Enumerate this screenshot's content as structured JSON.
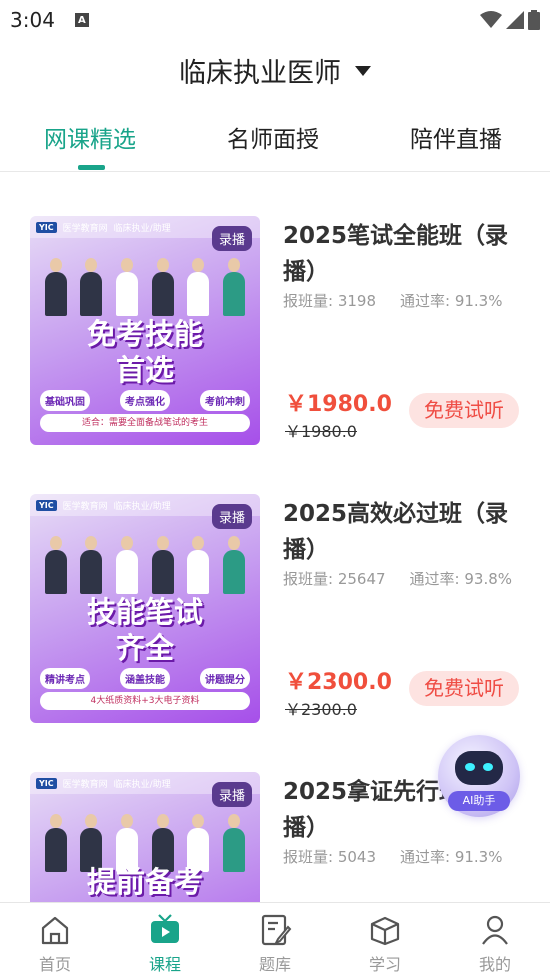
{
  "status_bar": {
    "time": "3:04",
    "notif_glyph": "A"
  },
  "header": {
    "title": "临床执业医师"
  },
  "tabs": [
    {
      "label": "网课精选",
      "active": true
    },
    {
      "label": "名师面授",
      "active": false
    },
    {
      "label": "陪伴直播",
      "active": false
    }
  ],
  "courses": [
    {
      "title": "2025笔试全能班（录播）",
      "enroll": "报班量: 3198",
      "pass_rate": "通过率: 91.3%",
      "price": "￥1980.0",
      "orig_price": "￥1980.0",
      "trial": "免费试听",
      "thumb": {
        "org": "医学教育网",
        "cat": "临床执业/助理",
        "badge": "录播",
        "headline1": "免考技能",
        "headline2": "首选",
        "pills": [
          "基础巩固",
          "考点强化",
          "考前冲刺"
        ],
        "footer": "适合：需要全面备战笔试的考生"
      }
    },
    {
      "title": "2025高效必过班（录播）",
      "enroll": "报班量: 25647",
      "pass_rate": "通过率: 93.8%",
      "price": "￥2300.0",
      "orig_price": "￥2300.0",
      "trial": "免费试听",
      "thumb": {
        "org": "医学教育网",
        "cat": "临床执业/助理",
        "badge": "录播",
        "headline1": "技能笔试",
        "headline2": "齐全",
        "pills": [
          "精讲考点",
          "涵盖技能",
          "讲题提分"
        ],
        "footer": "4大纸质资料+3大电子资料"
      }
    },
    {
      "title": "2025拿证先行班（录播）",
      "enroll": "报班量: 5043",
      "pass_rate": "通过率: 91.3%",
      "thumb": {
        "org": "医学教育网",
        "cat": "临床执业/助理",
        "badge": "录播",
        "headline1": "提前备考"
      }
    }
  ],
  "ai_assistant": {
    "label": "AI助手"
  },
  "bottom_nav": [
    {
      "label": "首页",
      "icon": "home-icon",
      "active": false
    },
    {
      "label": "课程",
      "icon": "tv-icon",
      "active": true
    },
    {
      "label": "题库",
      "icon": "notebook-pen-icon",
      "active": false
    },
    {
      "label": "学习",
      "icon": "box-icon",
      "active": false
    },
    {
      "label": "我的",
      "icon": "user-icon",
      "active": false
    }
  ],
  "colors": {
    "accent": "#19a48a",
    "price": "#f04f3c",
    "trial_bg": "#fde3e1"
  }
}
